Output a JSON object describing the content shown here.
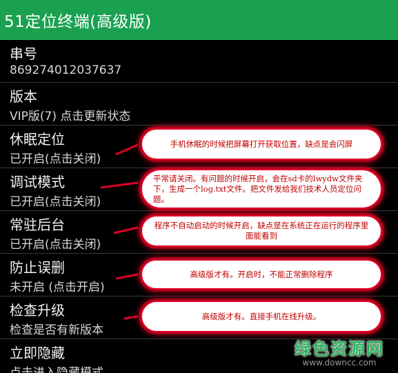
{
  "app": {
    "title": "51定位终端(高级版)"
  },
  "settings": [
    {
      "label": "串号",
      "sub": "869274012037637"
    },
    {
      "label": "版本",
      "sub": "VIP版(7) 点击更新状态"
    },
    {
      "label": "休眠定位",
      "sub": "已开启(点击关闭)"
    },
    {
      "label": "调试模式",
      "sub": "已开启(点击关闭)"
    },
    {
      "label": "常驻后台",
      "sub": "已开启(点击关闭)"
    },
    {
      "label": "防止误删",
      "sub": "未开启 (点击开启)"
    },
    {
      "label": "检查升级",
      "sub": "检查是否有新版本"
    },
    {
      "label": "立即隐藏",
      "sub": "点击进入隐藏模式"
    }
  ],
  "callouts": [
    "手机休眠的时候把屏幕打开获取位置，缺点是会闪屏",
    "平常请关闭。有问题的时候开启，会在sd卡的lwydw文件夹下，生成一个log.txt文件。把文件发给我们技术人员定位问题。",
    "程序不自动启动的时候开启，缺点是在系统正在运行的程序里面能看到",
    "高级版才有。开启时，不能正常删除程序",
    "高级版才有。直接手机在线升级。"
  ],
  "watermark": {
    "main": "绿色资源网",
    "url": "www.downcc.com"
  },
  "colors": {
    "titlebar": "#1aa150",
    "callout_border": "#e0002a",
    "callout_text": "#c00000"
  }
}
